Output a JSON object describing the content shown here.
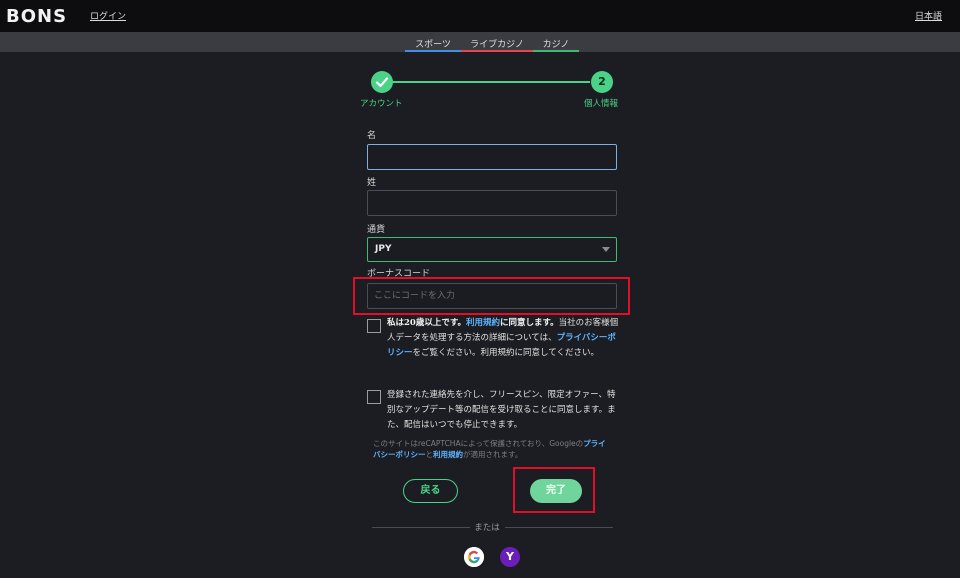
{
  "header": {
    "logo_text": "BONS",
    "login_label": "ログイン",
    "language_label": "日本語"
  },
  "tabs": [
    {
      "label": "スポーツ",
      "color": "#3f8fe6"
    },
    {
      "label": "ライブカジノ",
      "color": "#e6464f"
    },
    {
      "label": "カジノ",
      "color": "#3dbb72"
    }
  ],
  "stepper": {
    "steps": [
      {
        "label": "アカウント",
        "state": "done"
      },
      {
        "label": "個人情報",
        "number": "2",
        "state": "current"
      }
    ]
  },
  "form": {
    "first_name_label": "名",
    "first_name_value": "",
    "last_name_label": "姓",
    "last_name_value": "",
    "currency_label": "通貨",
    "currency_value": "JPY",
    "bonus_code_label": "ボーナスコード",
    "bonus_code_placeholder": "ここにコードを入力"
  },
  "consents": {
    "age": {
      "bold_prefix": "私は20歳以上です。",
      "terms_link": "利用規約",
      "bold_suffix": "に同意します。",
      "text_1": "当社のお客様個人データを処理する方法の詳細については、",
      "privacy_link": "プライバシーポリシー",
      "text_2": "をご覧ください。利用規約に同意してください。"
    },
    "marketing": {
      "text": "登録された連絡先を介し、フリースピン、限定オファー、特別なアップデート等の配信を受け取ることに同意します。また、配信はいつでも停止できます。"
    }
  },
  "recaptcha": {
    "text_1": "このサイトはreCAPTCHAによって保護されており、Googleの",
    "privacy_link": "プライバシーポリシー",
    "and": "と",
    "terms_link": "利用規約",
    "text_2": "が適用されます。"
  },
  "buttons": {
    "back_label": "戻る",
    "done_label": "完了"
  },
  "divider_text": "または",
  "social": [
    {
      "name": "google",
      "glyph": "G"
    },
    {
      "name": "yahoo",
      "glyph": "Y"
    }
  ],
  "colors": {
    "accent_green": "#4ad388",
    "highlight_red": "#e0102b",
    "link_blue": "#5fb4ff"
  }
}
